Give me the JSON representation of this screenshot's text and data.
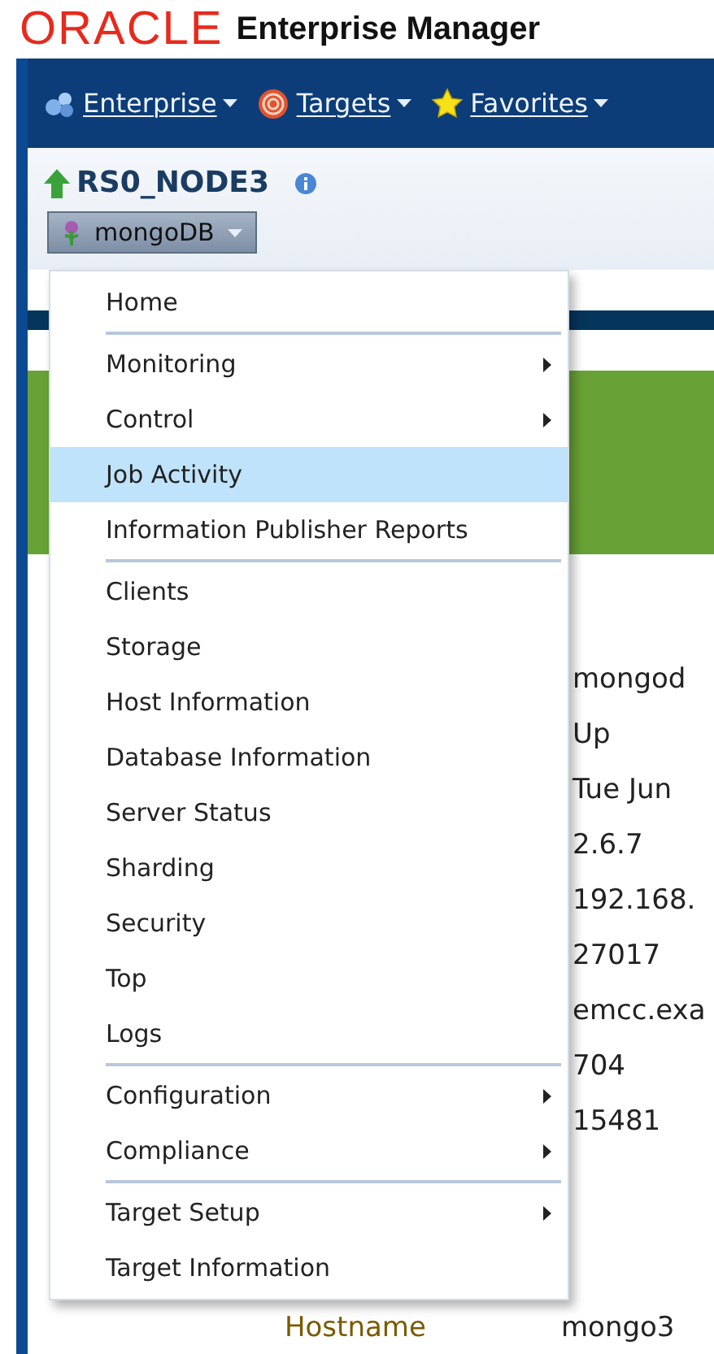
{
  "brand": {
    "logo": "ORACLE",
    "product": "Enterprise Manager"
  },
  "nav": [
    {
      "label": "Enterprise",
      "kind": "enterprise"
    },
    {
      "label": "Targets",
      "kind": "targets"
    },
    {
      "label": "Favorites",
      "kind": "favorites"
    }
  ],
  "target": {
    "name": "RS0_NODE3",
    "type_menu": "mongoDB"
  },
  "menu": {
    "groups": [
      [
        {
          "label": "Home",
          "submenu": false,
          "selected": false
        }
      ],
      [
        {
          "label": "Monitoring",
          "submenu": true,
          "selected": false
        },
        {
          "label": "Control",
          "submenu": true,
          "selected": false
        },
        {
          "label": "Job Activity",
          "submenu": false,
          "selected": true
        },
        {
          "label": "Information Publisher Reports",
          "submenu": false,
          "selected": false
        }
      ],
      [
        {
          "label": "Clients",
          "submenu": false,
          "selected": false
        },
        {
          "label": "Storage",
          "submenu": false,
          "selected": false
        },
        {
          "label": "Host Information",
          "submenu": false,
          "selected": false
        },
        {
          "label": "Database Information",
          "submenu": false,
          "selected": false
        },
        {
          "label": "Server Status",
          "submenu": false,
          "selected": false
        },
        {
          "label": "Sharding",
          "submenu": false,
          "selected": false
        },
        {
          "label": "Security",
          "submenu": false,
          "selected": false
        },
        {
          "label": "Top",
          "submenu": false,
          "selected": false
        },
        {
          "label": "Logs",
          "submenu": false,
          "selected": false
        }
      ],
      [
        {
          "label": "Configuration",
          "submenu": true,
          "selected": false
        },
        {
          "label": "Compliance",
          "submenu": true,
          "selected": false
        }
      ],
      [
        {
          "label": "Target Setup",
          "submenu": true,
          "selected": false
        },
        {
          "label": "Target Information",
          "submenu": false,
          "selected": false
        }
      ]
    ]
  },
  "details": {
    "values": [
      "mongod",
      "Up",
      "Tue Jun",
      "2.6.7",
      "192.168.",
      "27017",
      "emcc.exa",
      "704",
      "15481"
    ],
    "rows": [
      {
        "label": "Hostname",
        "value": "mongo3"
      }
    ]
  }
}
